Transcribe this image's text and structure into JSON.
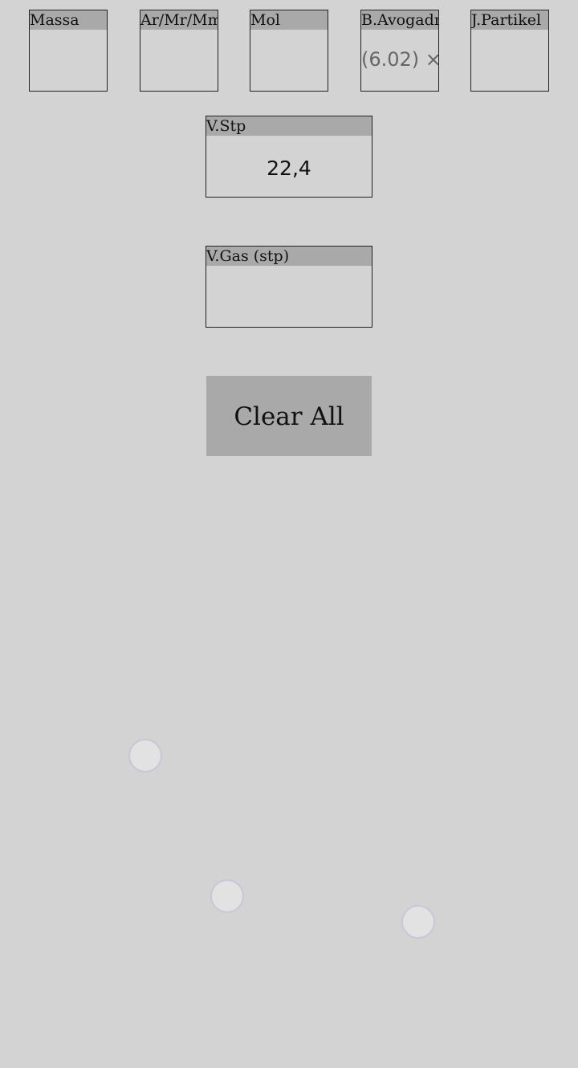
{
  "fields": {
    "massa": {
      "label": "Massa",
      "value": ""
    },
    "ar_mr_mm": {
      "label": "Ar/Mr/Mm",
      "value": ""
    },
    "mol": {
      "label": "Mol",
      "value": ""
    },
    "avogadro": {
      "label": "B.Avogadro",
      "value": "(6.02) ×"
    },
    "partikel": {
      "label": "J.Partikel",
      "value": ""
    },
    "v_stp": {
      "label": "V.Stp",
      "value": "22,4"
    },
    "v_gas": {
      "label": "V.Gas (stp)",
      "value": ""
    }
  },
  "actions": {
    "clear_all_label": "Clear All"
  }
}
